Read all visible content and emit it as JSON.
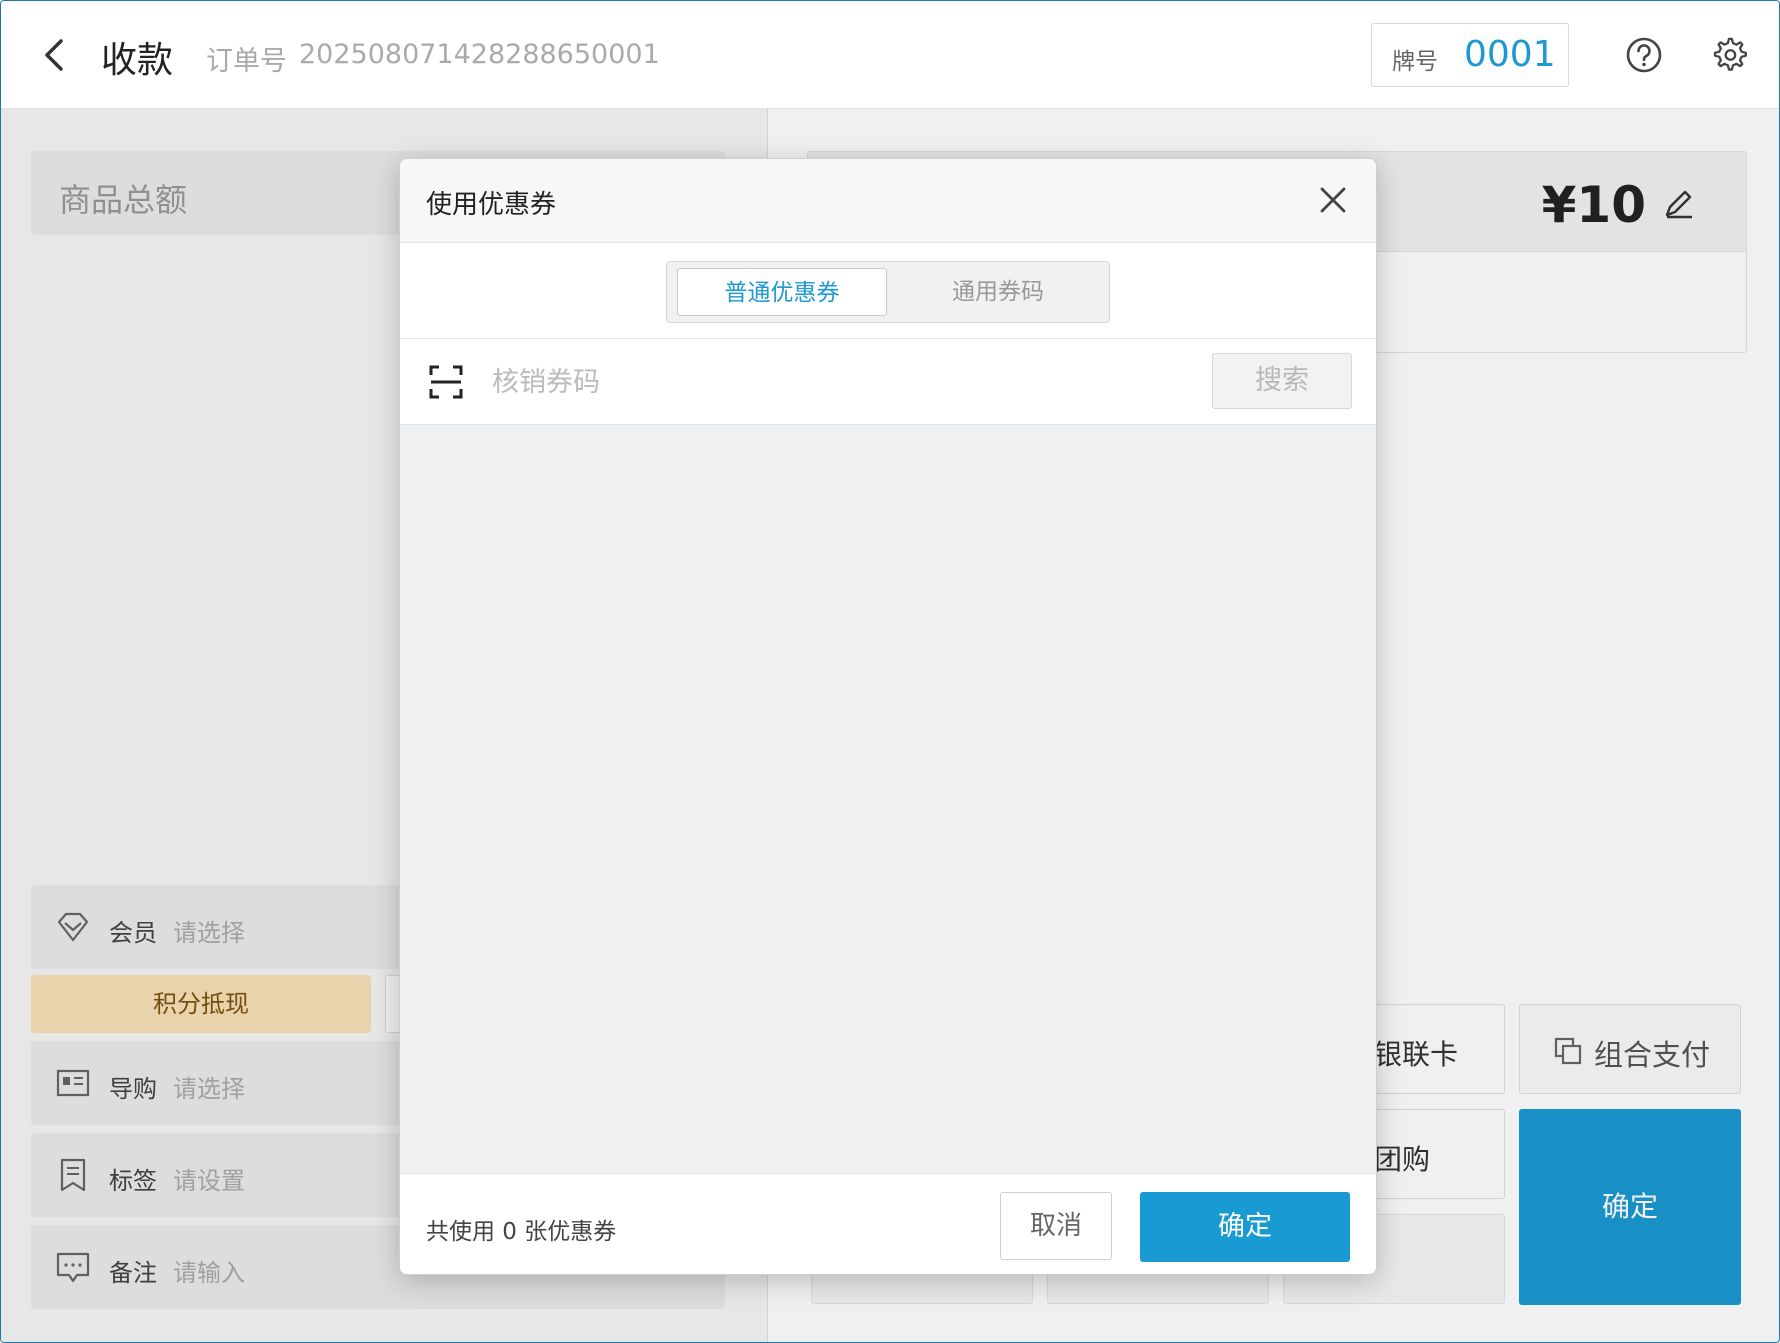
{
  "header": {
    "title": "收款",
    "order_label": "订单号",
    "order_no": "20250807142828865000​1",
    "tag_label": "牌号",
    "tag_no": "0001"
  },
  "left": {
    "goods_total_label": "商品总额",
    "member": {
      "label": "会员",
      "value": "请选择"
    },
    "points_button": "积分抵现",
    "guide": {
      "label": "导购",
      "value": "请选择"
    },
    "tag": {
      "label": "标签",
      "value": "请设置"
    },
    "note": {
      "label": "备注",
      "value": "请输入"
    }
  },
  "right": {
    "amount": "¥10",
    "pay_methods": [
      "银联卡",
      "团购"
    ],
    "combo_pay": "组合支付",
    "confirm": "确定"
  },
  "modal": {
    "title": "使用优惠券",
    "tabs": [
      {
        "label": "普通优惠券",
        "active": true
      },
      {
        "label": "通用券码",
        "active": false
      }
    ],
    "search_placeholder": "核销券码",
    "search_button": "搜索",
    "used_count_text": "共使用 0 张优惠券",
    "cancel": "取消",
    "ok": "确定"
  },
  "colors": {
    "accent": "#1a9ad3",
    "points_bg": "#f7e1b8"
  }
}
